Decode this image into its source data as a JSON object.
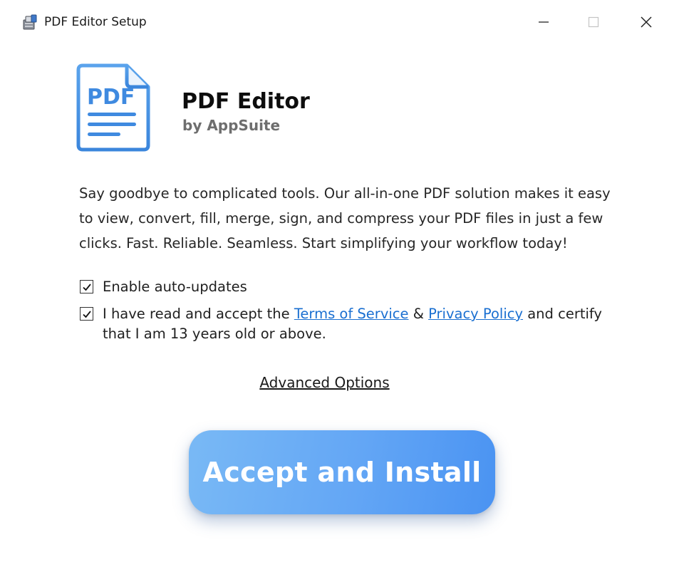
{
  "window": {
    "title": "PDF Editor Setup",
    "icon": "installer-icon"
  },
  "header": {
    "logo_text": "PDF",
    "product_name": "PDF Editor",
    "vendor": "by AppSuite",
    "accent_color": "#4a93e8"
  },
  "description": "Say goodbye to complicated tools. Our all-in-one PDF solution makes it easy to view, convert, fill, merge, sign, and compress your PDF files in just a few clicks. Fast. Reliable. Seamless. Start simplifying your workflow today!",
  "options": {
    "auto_updates": {
      "label": "Enable auto-updates",
      "checked": true
    },
    "terms": {
      "checked": true,
      "prefix": "I have read and accept the ",
      "tos_link": "Terms of Service",
      "amp": " & ",
      "privacy_link": "Privacy Policy",
      "suffix": " and certify that I am 13 years old or above."
    }
  },
  "advanced_link": "Advanced Options",
  "install_button": {
    "label": "Accept and Install",
    "color": "#5ea3f5"
  }
}
